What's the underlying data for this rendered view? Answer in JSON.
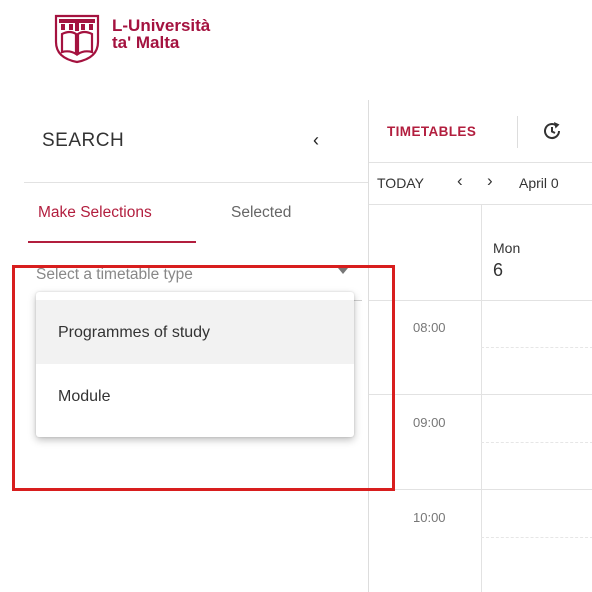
{
  "logo": {
    "line1": "L-Università",
    "line2": "ta' Malta",
    "brand_color": "#a4123f"
  },
  "search_panel": {
    "title": "SEARCH",
    "collapse_icon": "chevron-left-icon",
    "collapse_glyph": "‹",
    "tabs": [
      {
        "label": "Make Selections",
        "active": true
      },
      {
        "label": "Selected",
        "active": false
      }
    ],
    "select": {
      "placeholder": "Select a timetable type"
    },
    "dropdown_options": [
      {
        "label": "Programmes of study",
        "hovered": true
      },
      {
        "label": "Module",
        "hovered": false
      }
    ],
    "highlight_color": "#d81e1e"
  },
  "timetable": {
    "title": "TIMETABLES",
    "refresh_icon": "refresh-clock-icon",
    "today_label": "TODAY",
    "prev_glyph": "‹",
    "next_glyph": "›",
    "date_range": "April 0",
    "day": {
      "name": "Mon",
      "number": "6"
    },
    "times": [
      "08:00",
      "09:00",
      "10:00"
    ],
    "accent_color": "#b21e3e"
  }
}
